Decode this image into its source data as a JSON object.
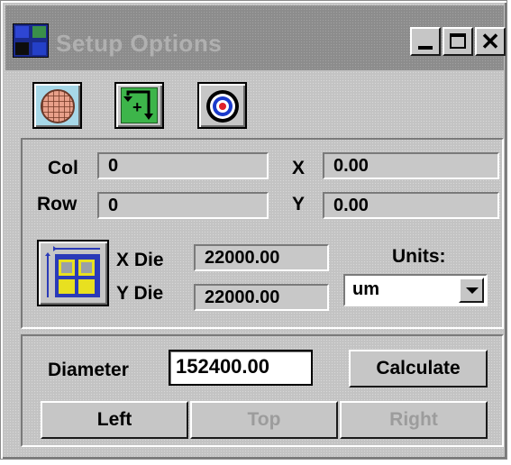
{
  "window": {
    "title": "Setup Options",
    "close_glyph": "✕"
  },
  "toolbar": {
    "icons": [
      "wafer-map-icon",
      "alignment-icon",
      "target-icon"
    ]
  },
  "position": {
    "col_label": "Col",
    "col_value": "0",
    "row_label": "Row",
    "row_value": "0",
    "x_label": "X",
    "x_value": "0.00",
    "y_label": "Y",
    "y_value": "0.00"
  },
  "die": {
    "x_label": "X Die",
    "x_value": "22000.00",
    "y_label": "Y Die",
    "y_value": "22000.00"
  },
  "units": {
    "label": "Units:",
    "selected": "um"
  },
  "diameter": {
    "label": "Diameter",
    "value": "152400.00"
  },
  "buttons": {
    "calculate": "Calculate",
    "left": "Left",
    "top": "Top",
    "right": "Right"
  },
  "colors": {
    "window_bg": "#c3c3c3",
    "titlebar_bg": "#8c8c8c",
    "wafer_button_bg": "#a7d8e8",
    "align_green": "#3db54a",
    "target_red": "#e0202a",
    "target_blue": "#1a3acb"
  }
}
